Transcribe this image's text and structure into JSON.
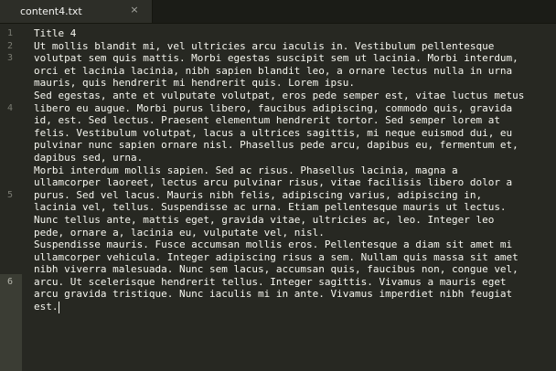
{
  "tab": {
    "filename": "content4.txt",
    "close_label": "×"
  },
  "gutter": {
    "numbers": [
      "1",
      "2",
      "3",
      "",
      "",
      "",
      "4",
      "",
      "",
      "",
      "",
      "",
      "",
      "5",
      "",
      "",
      "",
      "",
      "",
      "",
      "6",
      "",
      "",
      "",
      "",
      "",
      ""
    ]
  },
  "lines": [
    "Title 4",
    "",
    "Ut mollis blandit mi, vel ultricies arcu iaculis in. Vestibulum pellentesque",
    "volutpat sem quis mattis. Morbi egestas suscipit sem ut lacinia. Morbi interdum,",
    "orci et lacinia lacinia, nibh sapien blandit leo, a ornare lectus nulla in urna",
    "mauris, quis hendrerit mi hendrerit quis. Lorem ipsu.",
    "Sed egestas, ante et vulputate volutpat, eros pede semper est, vitae luctus metus",
    "libero eu augue. Morbi purus libero, faucibus adipiscing, commodo quis, gravida",
    "id, est. Sed lectus. Praesent elementum hendrerit tortor. Sed semper lorem at",
    "felis. Vestibulum volutpat, lacus a ultrices sagittis, mi neque euismod dui, eu",
    "pulvinar nunc sapien ornare nisl. Phasellus pede arcu, dapibus eu, fermentum et,",
    "dapibus sed, urna.",
    "Morbi interdum mollis sapien. Sed ac risus. Phasellus lacinia, magna a",
    "ullamcorper laoreet, lectus arcu pulvinar risus, vitae facilisis libero dolor a",
    "purus. Sed vel lacus. Mauris nibh felis, adipiscing varius, adipiscing in,",
    "lacinia vel, tellus. Suspendisse ac urna. Etiam pellentesque mauris ut lectus.",
    "Nunc tellus ante, mattis eget, gravida vitae, ultricies ac, leo. Integer leo",
    "pede, ornare a, lacinia eu, vulputate vel, nisl.",
    "Suspendisse mauris. Fusce accumsan mollis eros. Pellentesque a diam sit amet mi",
    "ullamcorper vehicula. Integer adipiscing risus a sem. Nullam quis massa sit amet",
    "nibh viverra malesuada. Nunc sem lacus, accumsan quis, faucibus non, congue vel,",
    "arcu. Ut scelerisque hendrerit tellus. Integer sagittis. Vivamus a mauris eget",
    "arcu gravida tristique. Nunc iaculis mi in ante. Vivamus imperdiet nibh feugiat",
    "est."
  ]
}
